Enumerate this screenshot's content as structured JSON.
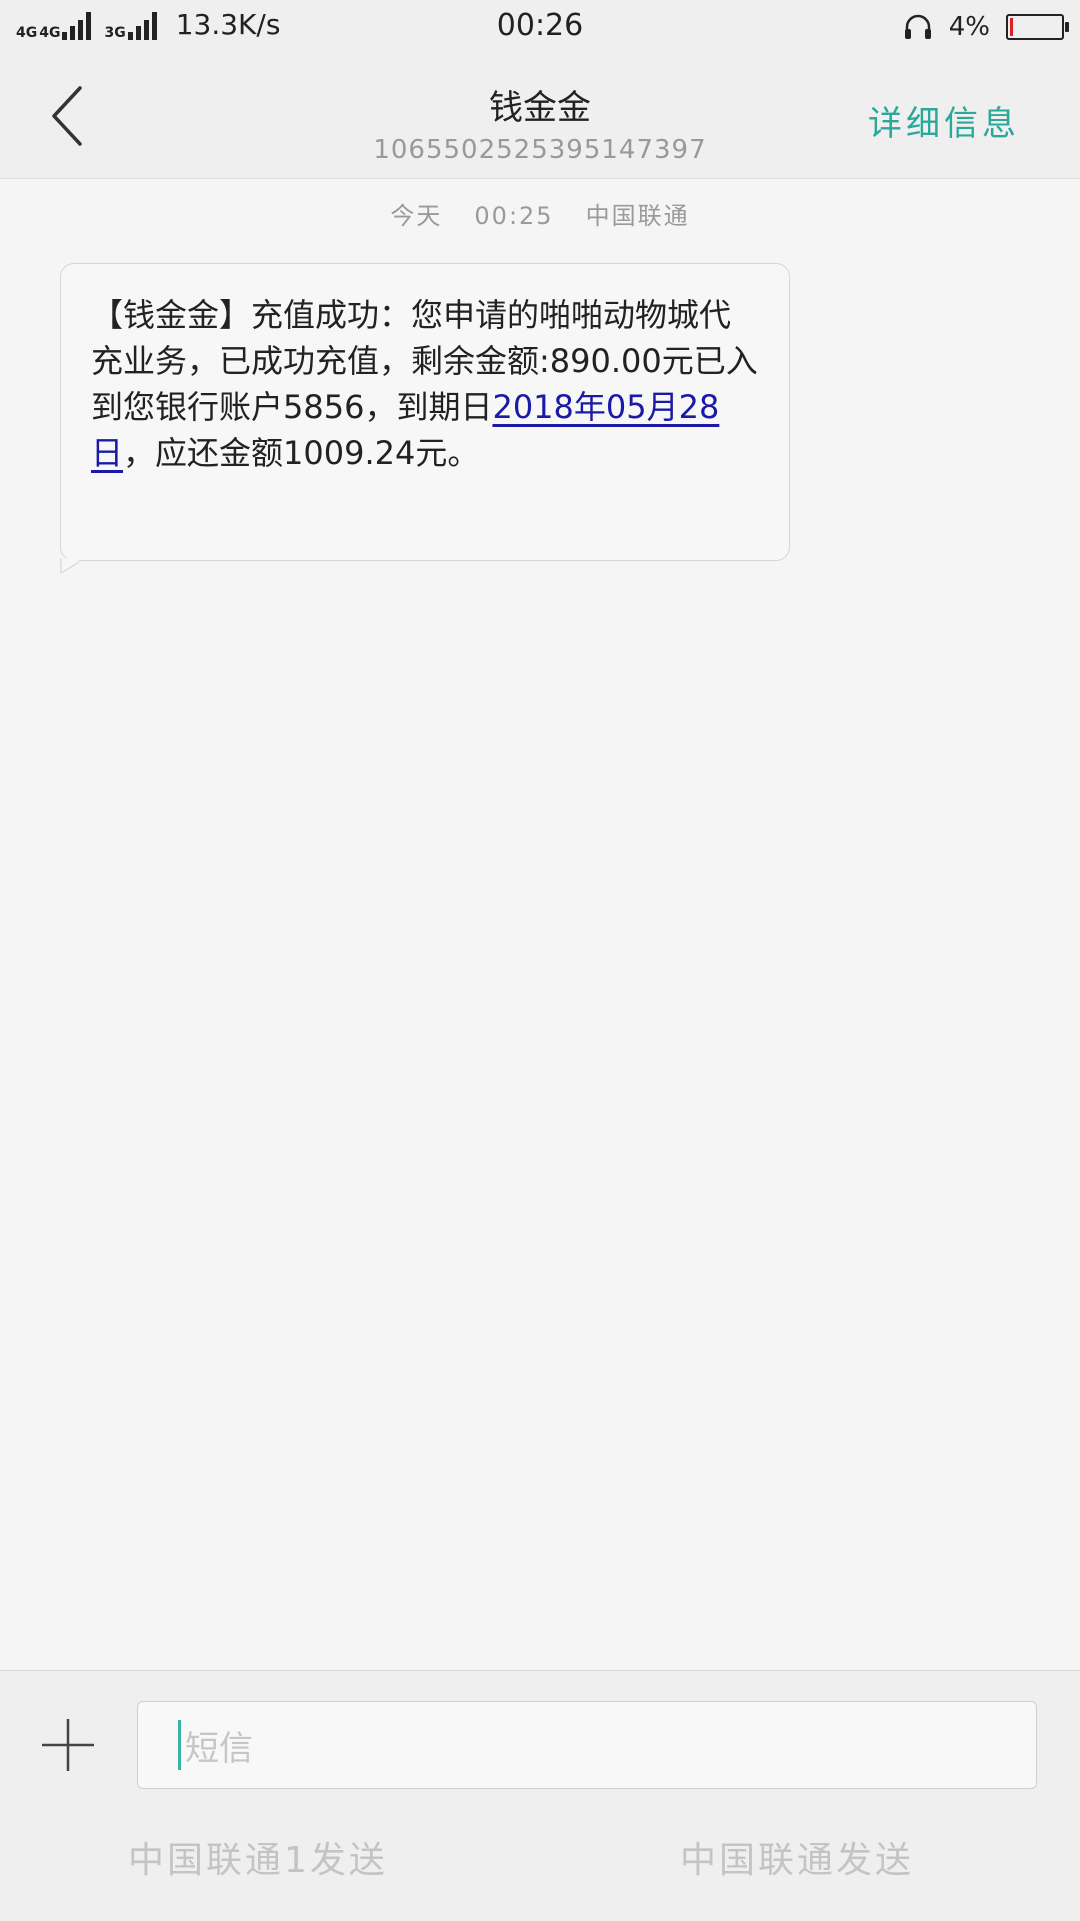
{
  "status_bar": {
    "network_1": "4G",
    "network_2": "4G",
    "network_3": "3G",
    "speed": "13.3K/s",
    "time": "00:26",
    "battery_percent": "4%",
    "battery_level": 0.04
  },
  "header": {
    "title": "钱金金",
    "number": "1065502525395147397",
    "detail_label": "详细信息"
  },
  "conversation": {
    "date_label": "今天",
    "time": "00:25",
    "carrier": "中国联通",
    "message": {
      "text_before_link": "【钱金金】充值成功：您申请的啪啪动物城代充业务，已成功充值，剩余金额:890.00元已入到您银行账户5856，到期日",
      "link_text": "2018年05月28日",
      "text_after_link": "，应还金额1009.24元。"
    }
  },
  "composer": {
    "placeholder": "短信",
    "send_sim1_label": "中国联通1发送",
    "send_sim2_label": "中国联通发送"
  },
  "colors": {
    "accent": "#2aa99a",
    "link": "#1a1aa6"
  },
  "icons": {
    "back": "back-chevron-icon",
    "add": "plus-icon",
    "headset": "headset-icon",
    "battery": "battery-icon"
  }
}
